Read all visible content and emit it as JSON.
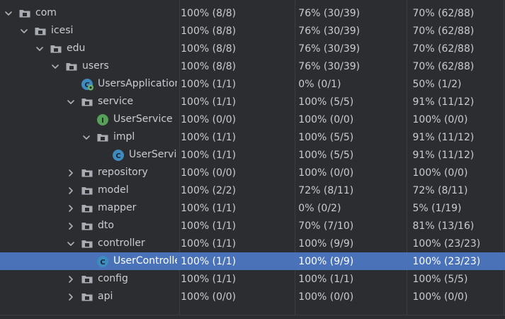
{
  "rows": [
    {
      "name": "com",
      "level": 0,
      "arrow": "down",
      "icon": "folder-icon",
      "classes": "100% (8/8)",
      "methods": "76% (30/39)",
      "lines": "70% (62/88)"
    },
    {
      "name": "icesi",
      "level": 1,
      "arrow": "down",
      "icon": "folder-icon",
      "classes": "100% (8/8)",
      "methods": "76% (30/39)",
      "lines": "70% (62/88)"
    },
    {
      "name": "edu",
      "level": 2,
      "arrow": "down",
      "icon": "folder-icon",
      "classes": "100% (8/8)",
      "methods": "76% (30/39)",
      "lines": "70% (62/88)"
    },
    {
      "name": "users",
      "level": 3,
      "arrow": "down",
      "icon": "folder-icon",
      "classes": "100% (8/8)",
      "methods": "76% (30/39)",
      "lines": "70% (62/88)"
    },
    {
      "name": "UsersApplication",
      "level": 4,
      "arrow": "none",
      "icon": "spring-app-icon",
      "classes": "100% (1/1)",
      "methods": "0% (0/1)",
      "lines": "50% (1/2)"
    },
    {
      "name": "service",
      "level": 4,
      "arrow": "down",
      "icon": "folder-icon",
      "classes": "100% (1/1)",
      "methods": "100% (5/5)",
      "lines": "91% (11/12)"
    },
    {
      "name": "UserService",
      "level": 5,
      "arrow": "none",
      "icon": "interface-icon",
      "classes": "100% (0/0)",
      "methods": "100% (0/0)",
      "lines": "100% (0/0)"
    },
    {
      "name": "impl",
      "level": 5,
      "arrow": "down",
      "icon": "folder-icon",
      "classes": "100% (1/1)",
      "methods": "100% (5/5)",
      "lines": "91% (11/12)"
    },
    {
      "name": "UserServic",
      "level": 6,
      "arrow": "none",
      "icon": "class-icon",
      "classes": "100% (1/1)",
      "methods": "100% (5/5)",
      "lines": "91% (11/12)"
    },
    {
      "name": "repository",
      "level": 4,
      "arrow": "right",
      "icon": "folder-icon",
      "classes": "100% (0/0)",
      "methods": "100% (0/0)",
      "lines": "100% (0/0)"
    },
    {
      "name": "model",
      "level": 4,
      "arrow": "right",
      "icon": "folder-icon",
      "classes": "100% (2/2)",
      "methods": "72% (8/11)",
      "lines": "72% (8/11)"
    },
    {
      "name": "mapper",
      "level": 4,
      "arrow": "right",
      "icon": "folder-icon",
      "classes": "100% (1/1)",
      "methods": "0% (0/2)",
      "lines": "5% (1/19)"
    },
    {
      "name": "dto",
      "level": 4,
      "arrow": "right",
      "icon": "folder-icon",
      "classes": "100% (1/1)",
      "methods": "70% (7/10)",
      "lines": "81% (13/16)"
    },
    {
      "name": "controller",
      "level": 4,
      "arrow": "down",
      "icon": "folder-icon",
      "classes": "100% (1/1)",
      "methods": "100% (9/9)",
      "lines": "100% (23/23)"
    },
    {
      "name": "UserControlle",
      "level": 5,
      "arrow": "none",
      "icon": "class-icon",
      "classes": "100% (1/1)",
      "methods": "100% (9/9)",
      "lines": "100% (23/23)",
      "selected": true
    },
    {
      "name": "config",
      "level": 4,
      "arrow": "right",
      "icon": "folder-icon",
      "classes": "100% (1/1)",
      "methods": "100% (1/1)",
      "lines": "100% (5/5)"
    },
    {
      "name": "api",
      "level": 4,
      "arrow": "right",
      "icon": "folder-icon",
      "classes": "100% (0/0)",
      "methods": "100% (0/0)",
      "lines": "100% (0/0)"
    }
  ],
  "colors": {
    "background": "#2b2d30",
    "selection": "#4a72b8",
    "text": "#c9ccd1",
    "folder": "#a9adb3",
    "class_badge": "#3d8bbf",
    "interface_badge": "#56a05a",
    "spring_badge": "#3d8bbf"
  }
}
